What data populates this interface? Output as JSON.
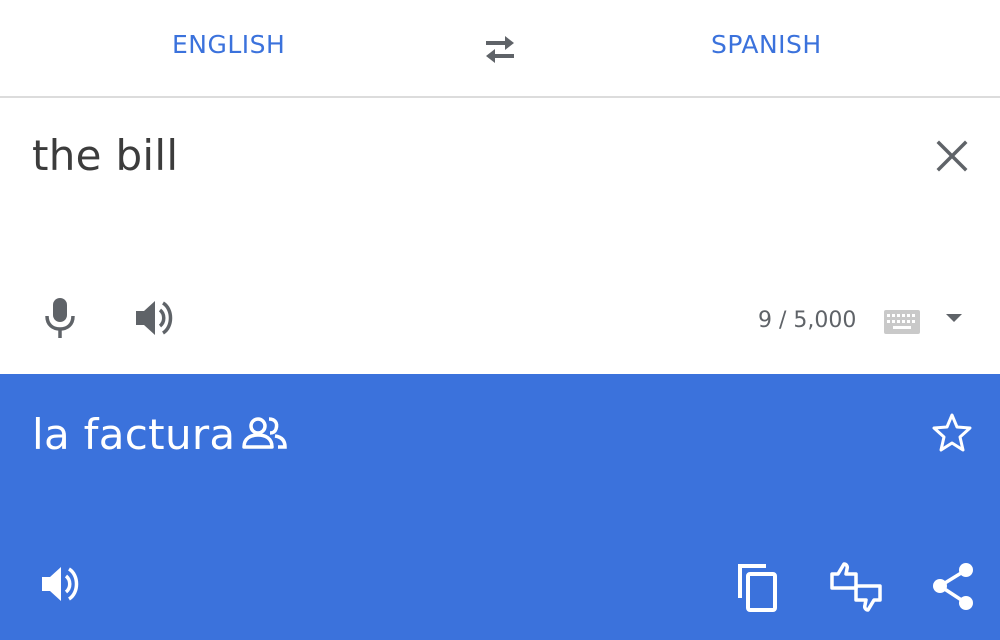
{
  "colors": {
    "accent": "#3b72dc",
    "output_background": "#3b72dc",
    "icon_gray": "#5f6368",
    "input_text": "#3c3c3c",
    "white": "#ffffff"
  },
  "language_bar": {
    "source_language": "ENGLISH",
    "target_language": "SPANISH",
    "swap_icon": "swap-arrows-icon"
  },
  "input": {
    "text": "the bill",
    "char_count": "9 / 5,000",
    "icons": [
      "close-icon",
      "mic-icon",
      "speaker-icon",
      "keyboard-icon",
      "dropdown-arrow-icon"
    ]
  },
  "output": {
    "text": "la factura",
    "icons": [
      "community-verified-icon",
      "star-icon",
      "speaker-icon",
      "copy-icon",
      "feedback-icon",
      "share-icon"
    ]
  }
}
